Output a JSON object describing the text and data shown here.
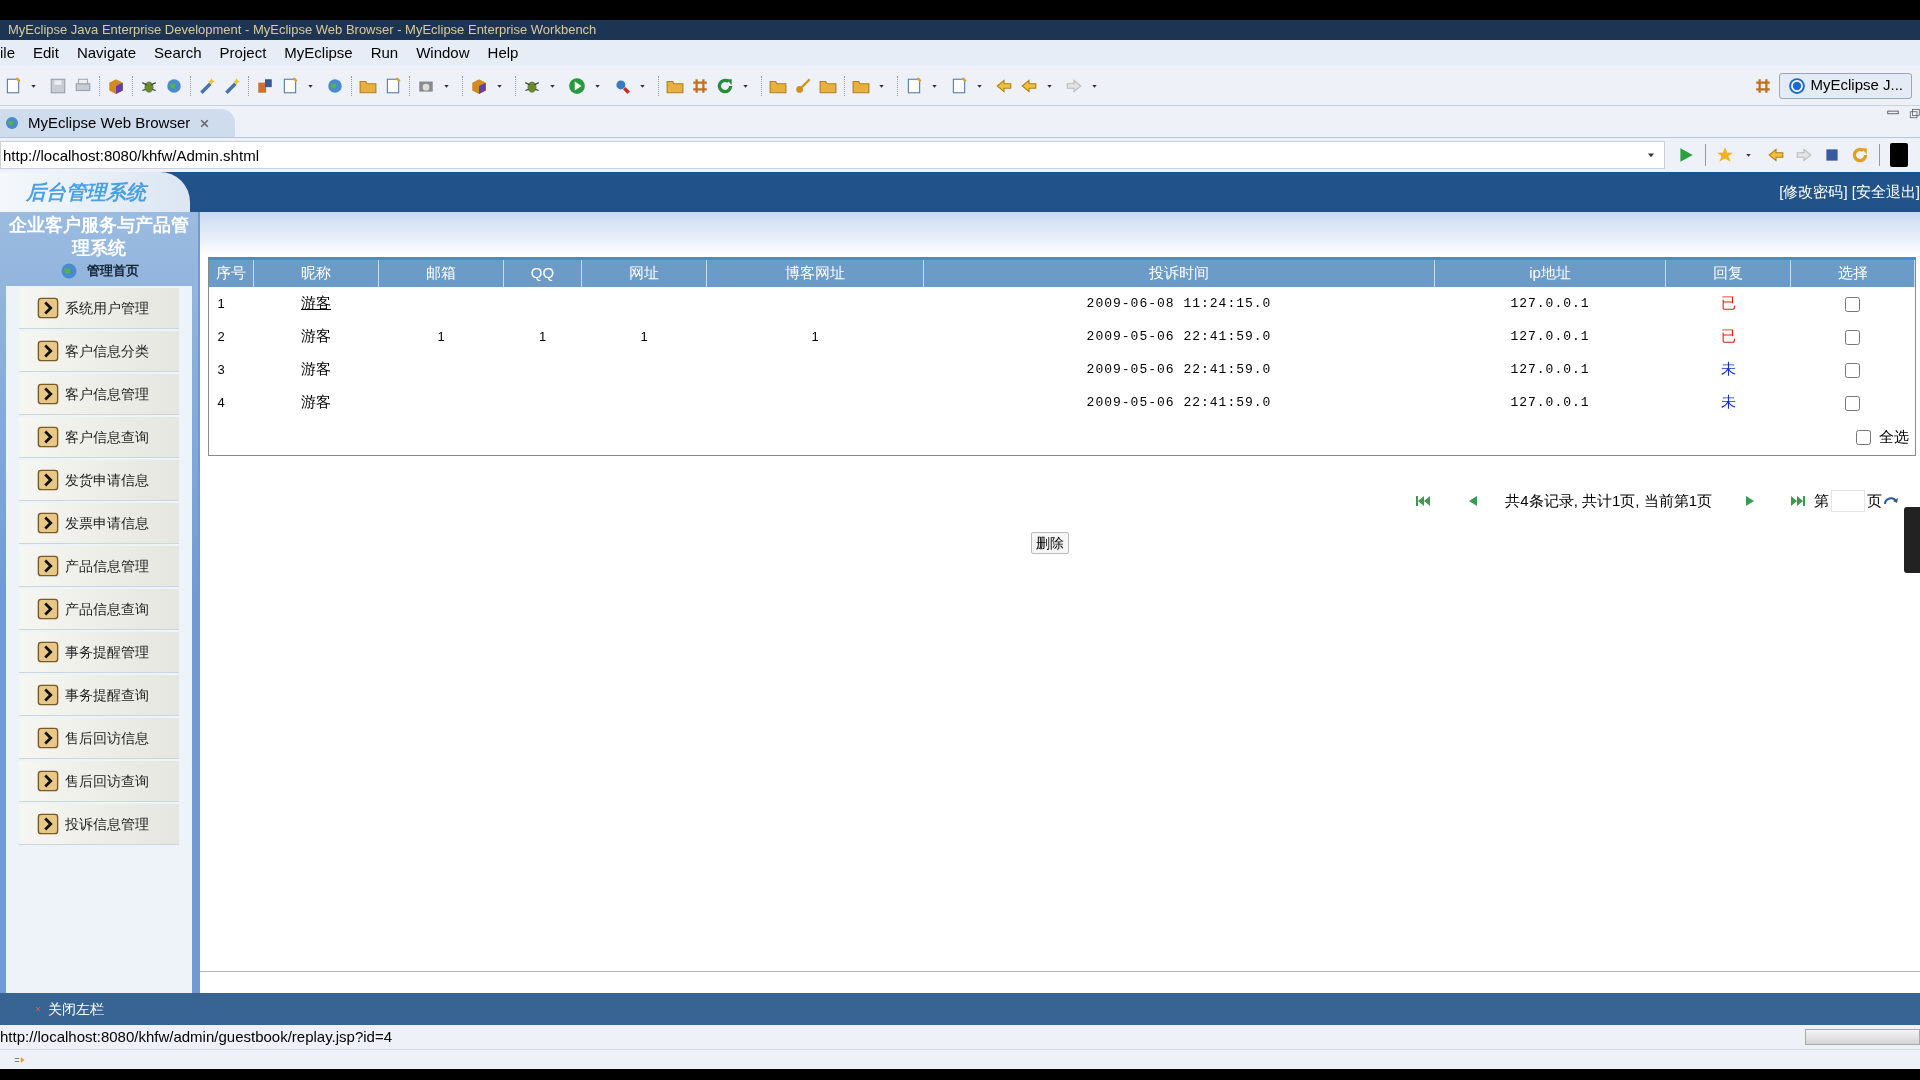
{
  "window": {
    "title": "MyEclipse Java Enterprise Development - MyEclipse Web Browser - MyEclipse Enterprise Workbench"
  },
  "menu": [
    "ile",
    "Edit",
    "Navigate",
    "Search",
    "Project",
    "MyEclipse",
    "Run",
    "Window",
    "Help"
  ],
  "perspective": {
    "label": "MyEclipse J..."
  },
  "editor_tab": {
    "label": "MyEclipse Web Browser",
    "selected": true
  },
  "address": {
    "value": "http://localhost:8080/khfw/Admin.shtml"
  },
  "page": {
    "logo": "后台管理系统",
    "system_name": "企业客户服务与产品管理系统",
    "home": "管理首页",
    "header_links": [
      "[修改密码]",
      "[安全退出]"
    ],
    "nav": [
      "系统用户管理",
      "客户信息分类",
      "客户信息管理",
      "客户信息查询",
      "发货申请信息",
      "发票申请信息",
      "产品信息管理",
      "产品信息查询",
      "事务提醒管理",
      "事务提醒查询",
      "售后回访信息",
      "售后回访查询",
      "投诉信息管理"
    ],
    "table": {
      "columns": [
        "序号",
        "昵称",
        "邮箱",
        "QQ",
        "网址",
        "博客网址",
        "投诉时间",
        "ip地址",
        "回复",
        "选择"
      ],
      "rows": [
        {
          "no": "1",
          "nickname": "游客",
          "time": "2009-06-08 11:24:15.0",
          "ip": "127.0.0.1",
          "reply": "已",
          "replied": true,
          "checked": false,
          "hovered": true
        },
        {
          "no": "2",
          "nickname": "游客",
          "email": "1",
          "qq": "1",
          "website": "1",
          "blog": "1",
          "time": "2009-05-06 22:41:59.0",
          "ip": "127.0.0.1",
          "reply": "已",
          "replied": true,
          "checked": false,
          "hovered": false
        },
        {
          "no": "3",
          "nickname": "游客",
          "time": "2009-05-06 22:41:59.0",
          "ip": "127.0.0.1",
          "reply": "未",
          "replied": false,
          "checked": false,
          "hovered": false
        },
        {
          "no": "4",
          "nickname": "游客",
          "time": "2009-05-06 22:41:59.0",
          "ip": "127.0.0.1",
          "reply": "未",
          "replied": false,
          "checked": false,
          "hovered": false
        }
      ]
    },
    "select_all": {
      "label": "全选",
      "checked": false
    },
    "pagination": {
      "summary": "共4条记录, 共计1页, 当前第1页",
      "page_prefix": "第",
      "page_suffix": "页"
    },
    "delete_button": "删除",
    "close_sidebar": "关闭左栏"
  },
  "status_bar": {
    "url": "http://localhost:8080/khfw/admin/guestbook/replay.jsp?id=4"
  }
}
